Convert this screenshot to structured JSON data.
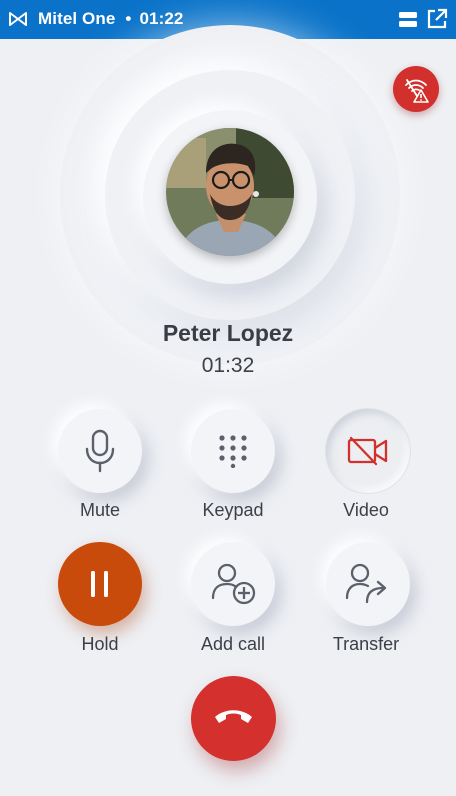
{
  "app": {
    "name": "Mitel One",
    "separator": "•",
    "clock": "01:22"
  },
  "caller": {
    "name": "Peter Lopez",
    "duration": "01:32"
  },
  "actions": {
    "mute": "Mute",
    "keypad": "Keypad",
    "video": "Video",
    "hold": "Hold",
    "add_call": "Add call",
    "transfer": "Transfer"
  },
  "colors": {
    "topbar": "#0a73c9",
    "background": "#eef0f4",
    "hold": "#c84b0b",
    "end_call": "#d3302e",
    "warning": "#d1302c",
    "video_off_icon": "#d1302c"
  },
  "icons": {
    "logo": "mitel-logo-icon",
    "menu": "menu-icon",
    "popout": "popout-icon",
    "network": "wifi-warning-icon",
    "mute": "microphone-icon",
    "keypad": "keypad-icon",
    "video": "video-off-icon",
    "hold": "pause-icon",
    "add_call": "add-person-icon",
    "transfer": "transfer-person-icon",
    "end_call": "hangup-icon"
  }
}
